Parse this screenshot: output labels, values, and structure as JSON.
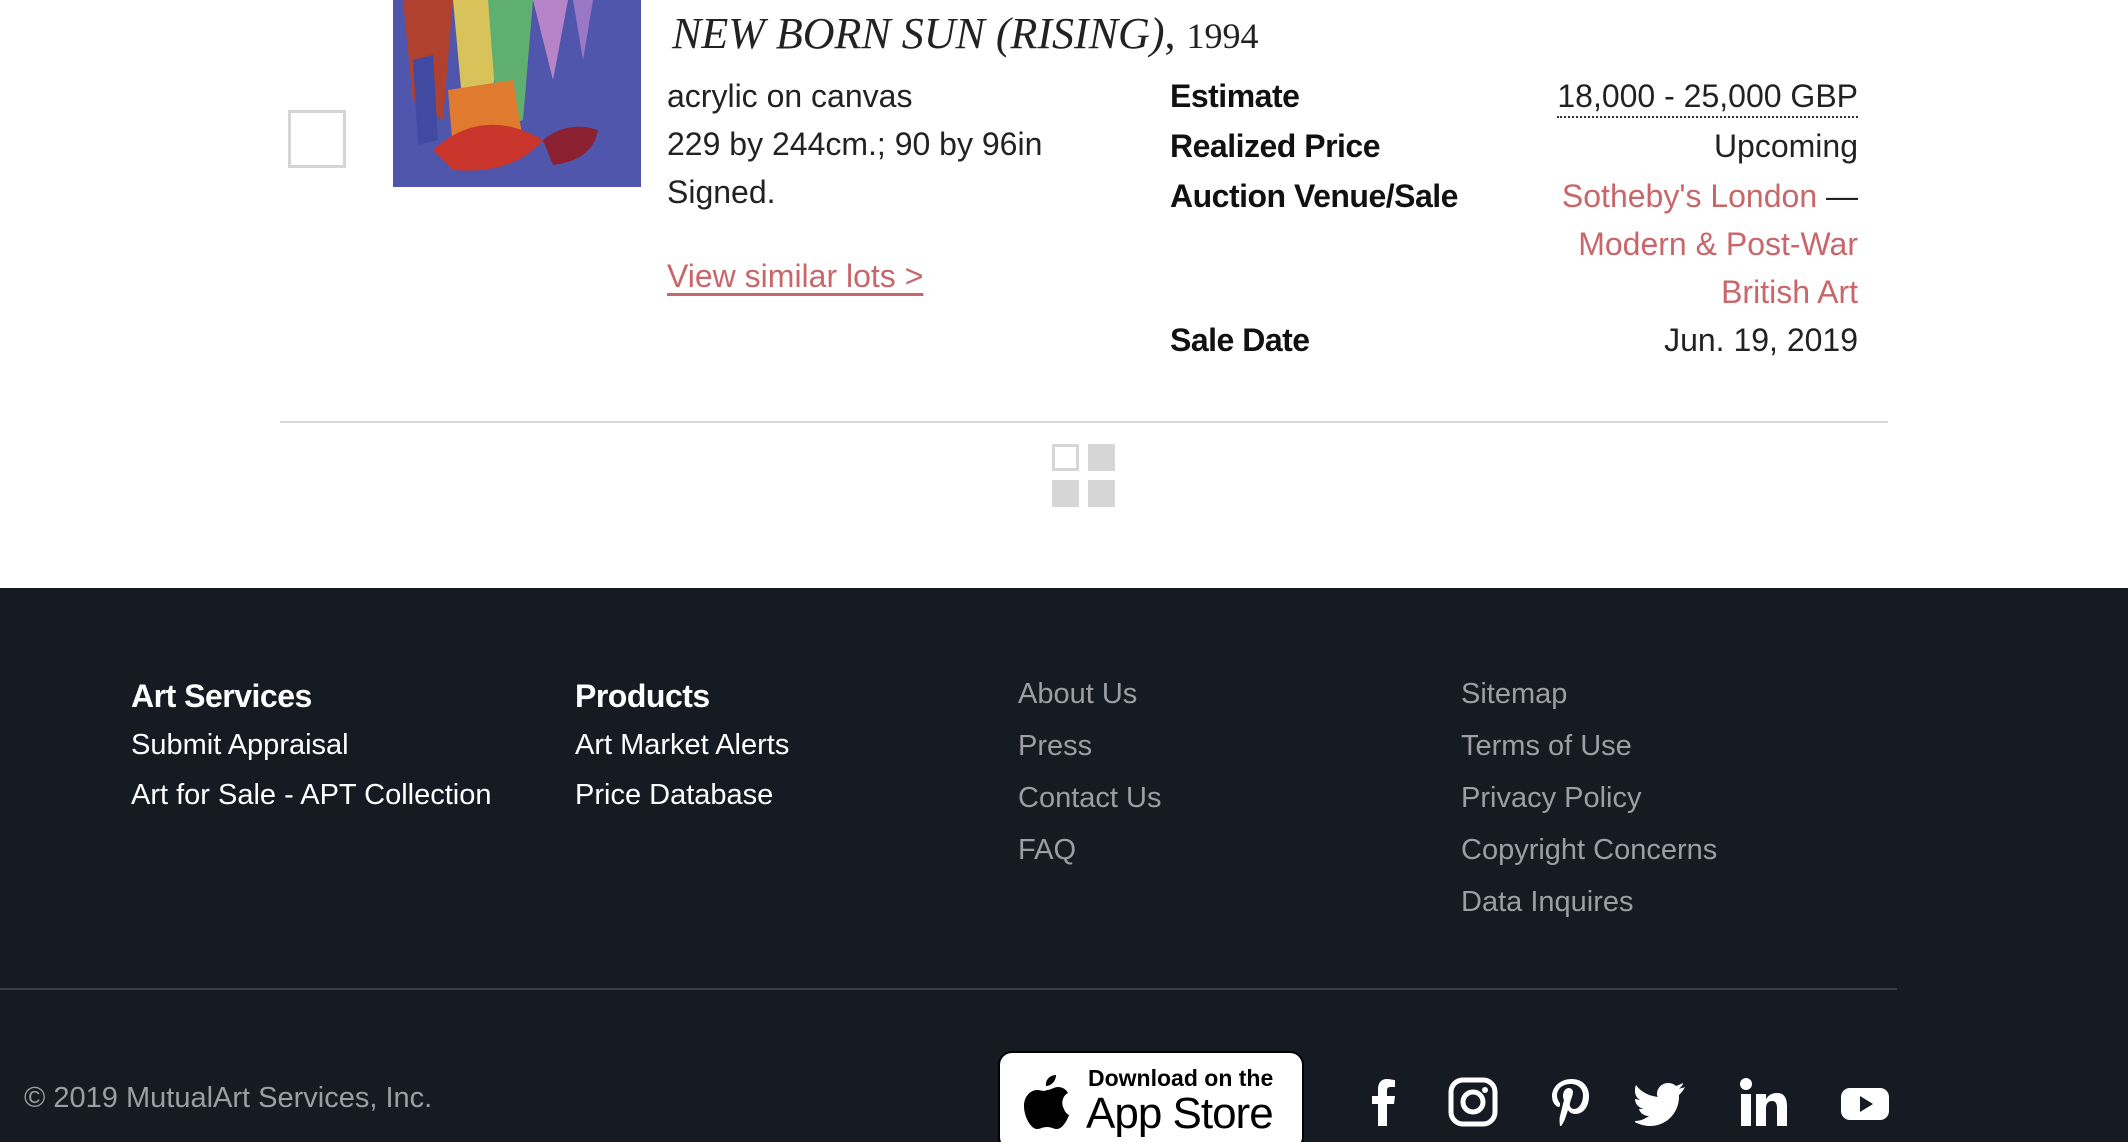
{
  "lot": {
    "title": "NEW BORN SUN (RISING)",
    "year_sep": ",",
    "year": "1994",
    "medium": "acrylic on canvas",
    "dimensions": "229 by 244cm.; 90 by 96in",
    "signature": "Signed.",
    "similar_link": "View similar lots >",
    "facts": {
      "estimate_label": "Estimate",
      "estimate_value": "18,000 - 25,000 GBP",
      "realized_label": "Realized Price",
      "realized_value": "Upcoming",
      "venue_label": "Auction Venue/Sale",
      "venue_name": "Sotheby's London",
      "venue_sep": " —",
      "sale_line1": "Modern & Post-War",
      "sale_line2": "British Art",
      "date_label": "Sale Date",
      "date_value": "Jun. 19, 2019"
    }
  },
  "footer": {
    "col1": {
      "heading": "Art Services",
      "items": [
        "Submit Appraisal",
        "Art for Sale - APT Collection"
      ]
    },
    "col2": {
      "heading": "Products",
      "items": [
        "Art Market Alerts",
        "Price Database"
      ]
    },
    "col3": {
      "items": [
        "About Us",
        "Press",
        "Contact Us",
        "FAQ"
      ]
    },
    "col4": {
      "items": [
        "Sitemap",
        "Terms of Use",
        "Privacy Policy",
        "Copyright Concerns",
        "Data Inquires"
      ]
    },
    "copyright": "© 2019 MutualArt Services, Inc.",
    "app_store": {
      "small": "Download on the",
      "big": "App Store"
    },
    "social_icons": [
      "facebook-icon",
      "instagram-icon",
      "pinterest-icon",
      "twitter-icon",
      "linkedin-icon",
      "youtube-icon"
    ]
  },
  "colors": {
    "link": "#c9666a",
    "footer_bg": "#161a23",
    "footer_muted": "#9c9ea4"
  }
}
